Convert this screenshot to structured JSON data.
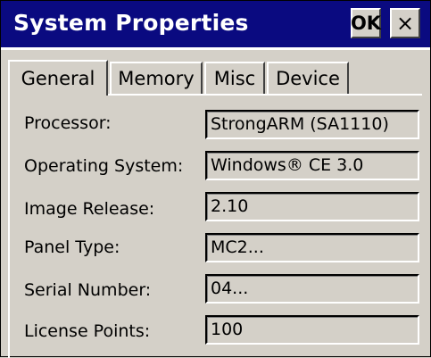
{
  "window": {
    "title": "System Properties",
    "ok_label": "OK",
    "close_label": "×"
  },
  "tabs": [
    {
      "label": "General",
      "active": true
    },
    {
      "label": "Memory",
      "active": false
    },
    {
      "label": "Misc",
      "active": false
    },
    {
      "label": "Device",
      "active": false
    }
  ],
  "general": {
    "rows": [
      {
        "label": "Processor:",
        "value": "StrongARM (SA1110)"
      },
      {
        "label": "Operating System:",
        "value": "Windows® CE 3.0"
      },
      {
        "label": "Image Release:",
        "value": "2.10"
      },
      {
        "label": "Panel Type:",
        "value": "MC2..."
      },
      {
        "label": "Serial Number:",
        "value": "04..."
      },
      {
        "label": "License Points:",
        "value": "100"
      }
    ]
  }
}
